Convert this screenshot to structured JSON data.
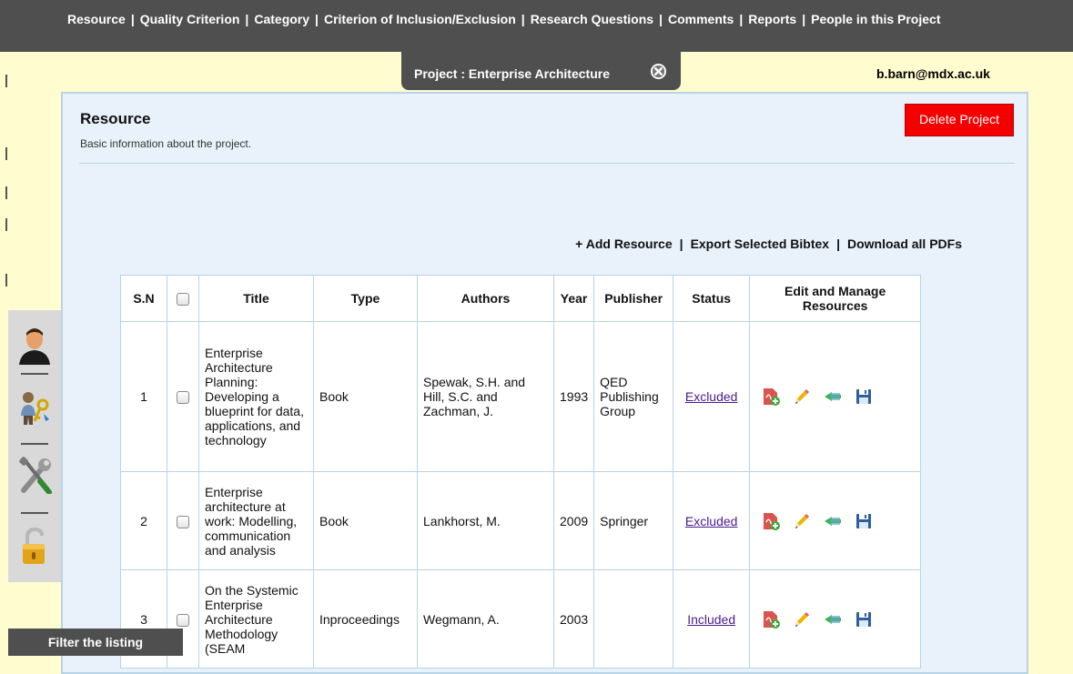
{
  "topnav": {
    "items": [
      "Resource",
      "Quality Criterion",
      "Category",
      "Criterion of Inclusion/Exclusion",
      "Research Questions",
      "Comments",
      "Reports",
      "People in this Project"
    ],
    "separator": "|"
  },
  "project_tab": {
    "title": "Project : Enterprise Architecture",
    "close_icon": "close-circle-icon"
  },
  "user": {
    "email": "b.barn@mdx.ac.uk"
  },
  "panel": {
    "title": "Resource",
    "subtitle": "Basic information about the project.",
    "delete_label": "Delete Project",
    "actions": [
      "+ Add Resource",
      "Export Selected Bibtex",
      "Download all PDFs"
    ],
    "action_separator": "|"
  },
  "table": {
    "headers": [
      "S.N",
      "",
      "Title",
      "Type",
      "Authors",
      "Year",
      "Publisher",
      "Status",
      "Edit and Manage Resources"
    ],
    "rows": [
      {
        "sn": "1",
        "title": "Enterprise Architecture Planning: Developing a blueprint for data, applications, and technology",
        "type": "Book",
        "authors": "Spewak, S.H. and Hill, S.C. and Zachman, J.",
        "year": "1993",
        "publisher": "QED Publishing Group",
        "status": "Excluded"
      },
      {
        "sn": "2",
        "title": "Enterprise architecture at work: Modelling, communication and analysis",
        "type": "Book",
        "authors": "Lankhorst, M.",
        "year": "2009",
        "publisher": "Springer",
        "status": "Excluded"
      },
      {
        "sn": "3",
        "title": "On the Systemic Enterprise Architecture Methodology (SEAM",
        "type": "Inproceedings",
        "authors": "Wegmann, A.",
        "year": "2003",
        "publisher": "",
        "status": "Included"
      }
    ],
    "row_icons": [
      "pdf-add-icon",
      "pencil-edit-icon",
      "forward-arrow-icon",
      "save-disk-icon"
    ]
  },
  "toolbar": {
    "icons": [
      "user-profile-icon",
      "person-key-icon",
      "tools-icon",
      "unlock-padlock-icon"
    ]
  },
  "filter": {
    "label": "Filter the listing"
  },
  "colors": {
    "nav_bg": "#4f4f4f",
    "page_bg": "#fffccf",
    "panel_bg": "#e9f2fb",
    "delete_red": "#f50000",
    "link_purple": "#4b1a8f"
  }
}
